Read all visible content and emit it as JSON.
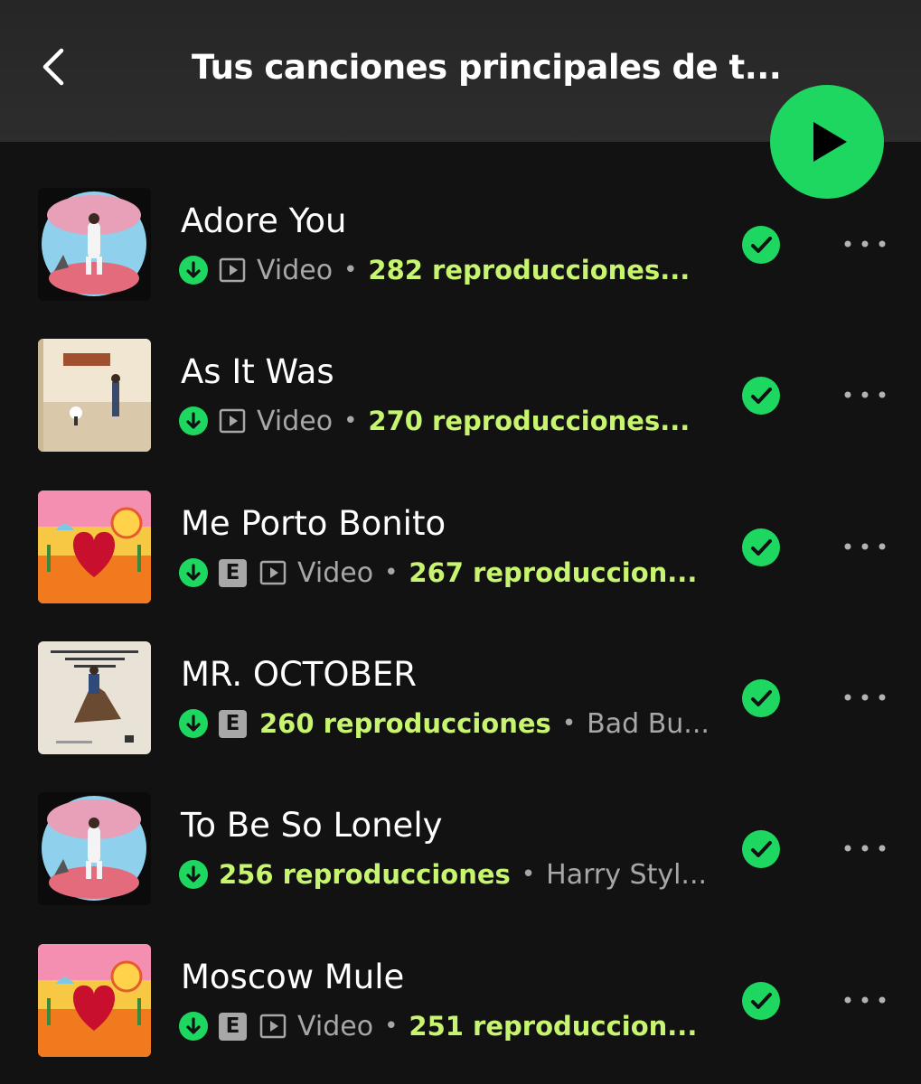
{
  "header": {
    "title": "Tus canciones principales de t...",
    "back_icon": "chevron-left-icon",
    "play_icon": "play-icon"
  },
  "colors": {
    "background": "#121212",
    "accent_green": "#1ed760",
    "plays_green": "#c8f56f",
    "secondary_text": "#a7a7a7"
  },
  "tracks": [
    {
      "title": "Adore You",
      "explicit": false,
      "video": true,
      "video_label": "Video",
      "plays": "282 reproducciones...",
      "artist": "",
      "cover": "harrys-house-fine-line-cover"
    },
    {
      "title": "As It Was",
      "explicit": false,
      "video": true,
      "video_label": "Video",
      "plays": "270 reproducciones...",
      "artist": "",
      "cover": "harrys-house-cover"
    },
    {
      "title": "Me Porto Bonito",
      "explicit": true,
      "explicit_label": "E",
      "video": true,
      "video_label": "Video",
      "plays": "267 reproduccion...",
      "artist": "",
      "cover": "un-verano-sin-ti-cover"
    },
    {
      "title": "MR. OCTOBER",
      "explicit": true,
      "explicit_label": "E",
      "video": false,
      "plays": "260 reproducciones",
      "artist": "Bad Bu...",
      "cover": "nadie-sabe-cover"
    },
    {
      "title": "To Be So Lonely",
      "explicit": false,
      "video": false,
      "plays": "256 reproducciones",
      "artist": "Harry Styl...",
      "cover": "fine-line-cover"
    },
    {
      "title": "Moscow Mule",
      "explicit": true,
      "explicit_label": "E",
      "video": true,
      "video_label": "Video",
      "plays": "251 reproduccion...",
      "artist": "",
      "cover": "un-verano-sin-ti-cover"
    }
  ],
  "separator": "•"
}
